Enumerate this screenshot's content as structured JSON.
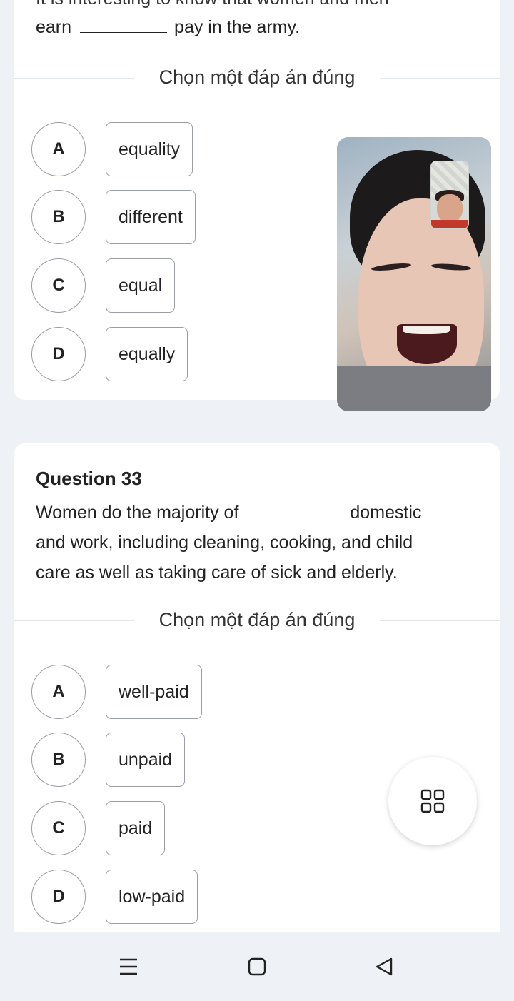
{
  "question_32_partial": {
    "cut_line": "It is interesting to know that women and men",
    "line_before_blank": "earn",
    "line_after_blank": "pay in the army.",
    "prompt_label": "Chọn một đáp án đúng",
    "options": [
      {
        "letter": "A",
        "text": "equality"
      },
      {
        "letter": "B",
        "text": "different"
      },
      {
        "letter": "C",
        "text": "equal"
      },
      {
        "letter": "D",
        "text": "equally"
      }
    ]
  },
  "question_33": {
    "title": "Question 33",
    "line1_before_blank": "Women do the majority of",
    "line1_after_blank": "domestic",
    "line2": "and work, including cleaning, cooking, and child",
    "line3": "care as well as taking care of sick and elderly.",
    "prompt_label": "Chọn một đáp án đúng",
    "options": [
      {
        "letter": "A",
        "text": "well-paid"
      },
      {
        "letter": "B",
        "text": "unpaid"
      },
      {
        "letter": "C",
        "text": "paid"
      },
      {
        "letter": "D",
        "text": "low-paid"
      }
    ]
  },
  "overlay": {
    "video_call": "video-call-window",
    "fab_icon": "grid-icon"
  },
  "navbar": {
    "icons": [
      "menu-icon",
      "home-icon",
      "back-icon"
    ]
  },
  "colors": {
    "page_bg": "#eef1f5",
    "card_bg": "#ffffff",
    "border": "#9a9ea4",
    "text": "#222222"
  }
}
